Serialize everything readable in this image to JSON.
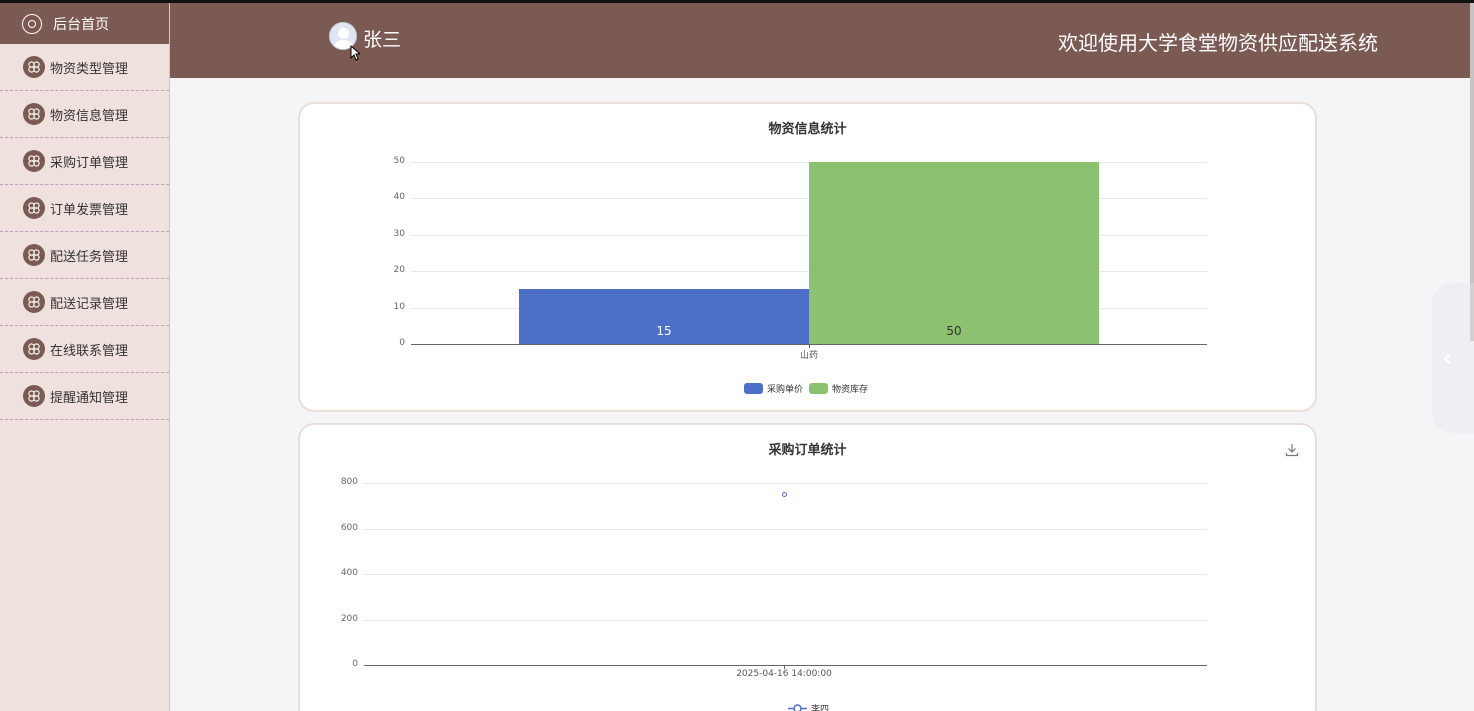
{
  "sidebar": {
    "home_label": "后台首页",
    "items": [
      {
        "label": "物资类型管理"
      },
      {
        "label": "物资信息管理"
      },
      {
        "label": "采购订单管理"
      },
      {
        "label": "订单发票管理"
      },
      {
        "label": "配送任务管理"
      },
      {
        "label": "配送记录管理"
      },
      {
        "label": "在线联系管理"
      },
      {
        "label": "提醒通知管理"
      }
    ]
  },
  "header": {
    "username": "张三",
    "site_title": "欢迎使用大学食堂物资供应配送系统"
  },
  "colors": {
    "brand": "#7b5a54",
    "sidebar_bg": "#efe1de",
    "series_blue": "#4d6fc7",
    "series_green": "#8bc16f"
  },
  "chart_data": [
    {
      "type": "bar",
      "title": "物资信息统计",
      "categories": [
        "山药"
      ],
      "series": [
        {
          "name": "采购单价",
          "values": [
            15
          ],
          "color": "#4d6fc7"
        },
        {
          "name": "物资库存",
          "values": [
            50
          ],
          "color": "#8bc16f"
        }
      ],
      "ylim": [
        0,
        50
      ],
      "yticks": [
        "0",
        "10",
        "20",
        "30",
        "40",
        "50"
      ],
      "grid": true,
      "legend_position": "bottom"
    },
    {
      "type": "scatter",
      "title": "采购订单统计",
      "x": [
        "2025-04-16 14:00:00"
      ],
      "series": [
        {
          "name": "李四",
          "values": [
            750
          ],
          "color": "#4d6fc7"
        }
      ],
      "ylim": [
        0,
        800
      ],
      "yticks": [
        "0",
        "200",
        "400",
        "600",
        "800"
      ],
      "grid": true,
      "legend_position": "bottom"
    }
  ]
}
